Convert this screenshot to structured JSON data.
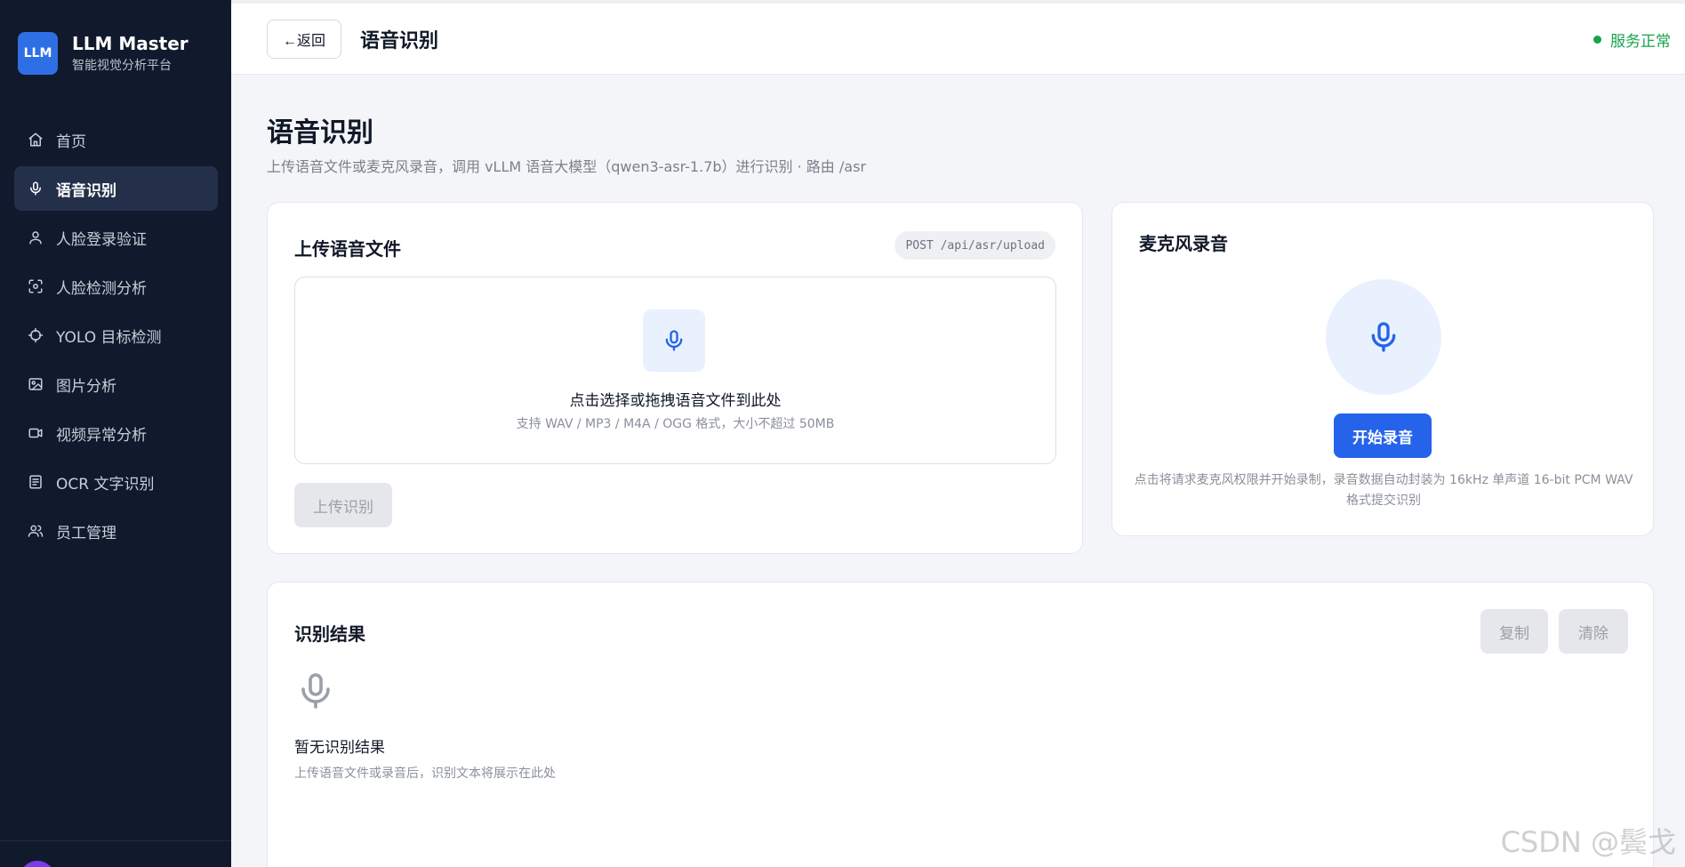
{
  "brand": {
    "logo": "LLM",
    "name": "LLM Master",
    "subtitle": "智能视觉分析平台"
  },
  "sidebar": {
    "items": [
      {
        "label": "首页",
        "icon": "home-icon",
        "active": false
      },
      {
        "label": "语音识别",
        "icon": "mic-icon",
        "active": true
      },
      {
        "label": "人脸登录验证",
        "icon": "user-icon",
        "active": false
      },
      {
        "label": "人脸检测分析",
        "icon": "face-scan-icon",
        "active": false
      },
      {
        "label": "YOLO 目标检测",
        "icon": "crosshair-icon",
        "active": false
      },
      {
        "label": "图片分析",
        "icon": "image-icon",
        "active": false
      },
      {
        "label": "视频异常分析",
        "icon": "video-icon",
        "active": false
      },
      {
        "label": "OCR 文字识别",
        "icon": "document-icon",
        "active": false
      },
      {
        "label": "员工管理",
        "icon": "users-icon",
        "active": false
      }
    ]
  },
  "topbar": {
    "back_label": "←返回",
    "title": "语音识别",
    "status": "服务正常"
  },
  "header": {
    "title": "语音识别",
    "subtitle": "上传语音文件或麦克风录音，调用 vLLM 语音大模型（qwen3-asr-1.7b）进行识别 · 路由 /asr"
  },
  "upload": {
    "title": "上传语音文件",
    "api": "POST /api/asr/upload",
    "dropzone_text": "点击选择或拖拽语音文件到此处",
    "dropzone_hint": "支持 WAV / MP3 / M4A / OGG 格式，大小不超过 50MB",
    "button": "上传识别"
  },
  "mic": {
    "title": "麦克风录音",
    "button": "开始录音",
    "hint": "点击将请求麦克风权限并开始录制，录音数据自动封装为 16kHz 单声道 16-bit PCM WAV 格式提交识别"
  },
  "result": {
    "title": "识别结果",
    "copy": "复制",
    "clear": "清除",
    "empty_title": "暂无识别结果",
    "empty_hint": "上传语音文件或录音后，识别文本将展示在此处"
  },
  "watermark": "CSDN @鬓戈",
  "colors": {
    "accent": "#2563eb",
    "sidebar": "#111a2c",
    "status": "#16a34a"
  }
}
